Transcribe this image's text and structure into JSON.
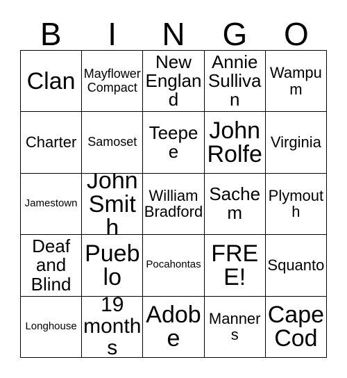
{
  "card": {
    "title": "BINGO",
    "header_letters": [
      "B",
      "I",
      "N",
      "G",
      "O"
    ],
    "columns": 5,
    "rows": 5,
    "free_space_label": "FREE!",
    "free_space_position": {
      "row": 4,
      "column": 4
    },
    "colors": {
      "background": "#ffffff",
      "cell_background": "#ffffff",
      "border": "#000000",
      "text": "#000000"
    },
    "grid": [
      [
        {
          "label": "Clan",
          "size": "xxl"
        },
        {
          "label": "Mayflower Compact",
          "size": "sm"
        },
        {
          "label": "New England",
          "size": "lg"
        },
        {
          "label": "Annie Sullivan",
          "size": "lg"
        },
        {
          "label": "Wampum",
          "size": "md"
        }
      ],
      [
        {
          "label": "Charter",
          "size": "md"
        },
        {
          "label": "Samoset",
          "size": "sm"
        },
        {
          "label": "Teepee",
          "size": "lg"
        },
        {
          "label": "John Rolfe",
          "size": "xxl"
        },
        {
          "label": "Virginia",
          "size": "md"
        }
      ],
      [
        {
          "label": "Jamestown",
          "size": "xs"
        },
        {
          "label": "John Smith",
          "size": "xxl"
        },
        {
          "label": "William Bradford",
          "size": "md"
        },
        {
          "label": "Sachem",
          "size": "lg"
        },
        {
          "label": "Plymouth",
          "size": "md"
        }
      ],
      [
        {
          "label": "Deaf and Blind",
          "size": "lg"
        },
        {
          "label": "Pueblo",
          "size": "xxl"
        },
        {
          "label": "Pocahontas",
          "size": "xs"
        },
        {
          "label": "FREE!",
          "size": "xxl"
        },
        {
          "label": "Squanto",
          "size": "md"
        }
      ],
      [
        {
          "label": "Longhouse",
          "size": "xs"
        },
        {
          "label": "19 months",
          "size": "xl"
        },
        {
          "label": "Adobe",
          "size": "xxl"
        },
        {
          "label": "Manners",
          "size": "md"
        },
        {
          "label": "Cape Cod",
          "size": "xxl"
        }
      ]
    ]
  }
}
